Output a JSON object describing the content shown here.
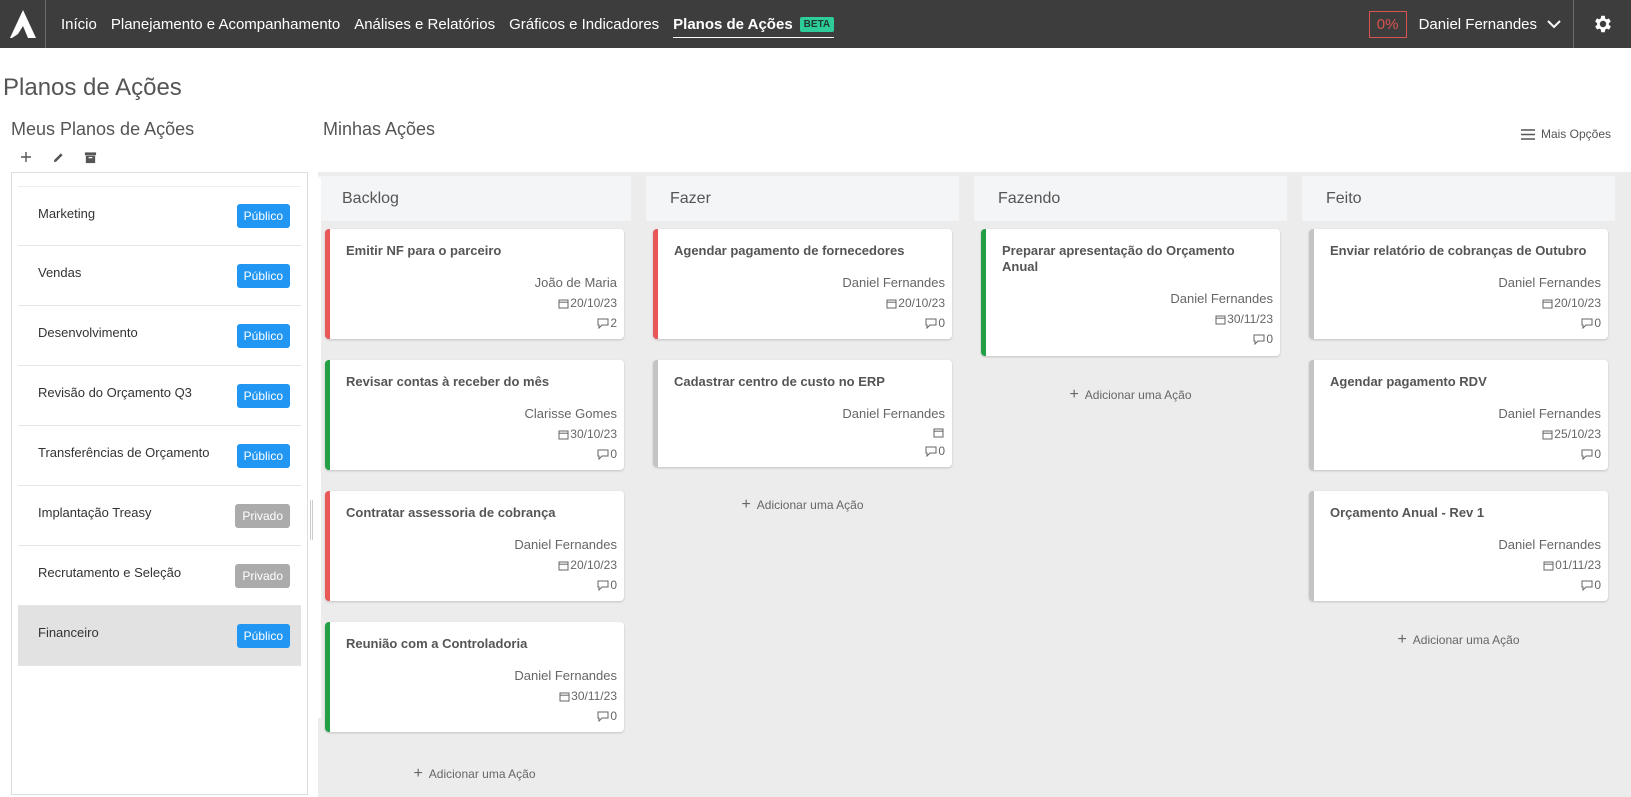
{
  "nav": {
    "items": [
      "Início",
      "Planejamento e Acompanhamento",
      "Análises e Relatórios",
      "Gráficos e Indicadores"
    ],
    "active": "Planos de Ações",
    "active_badge": "BETA"
  },
  "user": {
    "progress": "0%",
    "name": "Daniel Fernandes"
  },
  "page": {
    "title": "Planos de Ações"
  },
  "left": {
    "title": "Meus Planos de Ações",
    "plans": [
      {
        "name": "Marketing",
        "visibility": "Público"
      },
      {
        "name": "Vendas",
        "visibility": "Público"
      },
      {
        "name": "Desenvolvimento",
        "visibility": "Público"
      },
      {
        "name": "Revisão do Orçamento Q3",
        "visibility": "Público"
      },
      {
        "name": "Transferências de Orçamento",
        "visibility": "Público"
      },
      {
        "name": "Implantação Treasy",
        "visibility": "Privado"
      },
      {
        "name": "Recrutamento e Seleção",
        "visibility": "Privado"
      },
      {
        "name": "Financeiro",
        "visibility": "Público"
      }
    ]
  },
  "board": {
    "title": "Minhas Ações",
    "more_options": "Mais Opções",
    "add_action": "Adicionar uma Ação",
    "columns": [
      {
        "name": "Backlog",
        "cards": [
          {
            "title": "Emitir NF para o parceiro",
            "assignee": "João de Maria",
            "date": "20/10/23",
            "comments": "2"
          },
          {
            "title": "Revisar contas à receber do mês",
            "assignee": "Clarisse Gomes",
            "date": "30/10/23",
            "comments": "0"
          },
          {
            "title": "Contratar assessoria de cobrança",
            "assignee": "Daniel Fernandes",
            "date": "20/10/23",
            "comments": "0"
          },
          {
            "title": "Reunião com a Controladoria",
            "assignee": "Daniel Fernandes",
            "date": "30/11/23",
            "comments": "0"
          }
        ]
      },
      {
        "name": "Fazer",
        "cards": [
          {
            "title": "Agendar pagamento de fornecedores",
            "assignee": "Daniel Fernandes",
            "date": "20/10/23",
            "comments": "0"
          },
          {
            "title": "Cadastrar centro de custo no ERP",
            "assignee": "Daniel Fernandes",
            "date": "",
            "comments": "0"
          }
        ]
      },
      {
        "name": "Fazendo",
        "cards": [
          {
            "title": "Preparar apresentação do Orçamento Anual",
            "assignee": "Daniel Fernandes",
            "date": "30/11/23",
            "comments": "0"
          }
        ]
      },
      {
        "name": "Feito",
        "cards": [
          {
            "title": "Enviar relatório de cobranças de Outubro",
            "assignee": "Daniel Fernandes",
            "date": "20/10/23",
            "comments": "0"
          },
          {
            "title": "Agendar pagamento RDV",
            "assignee": "Daniel Fernandes",
            "date": "25/10/23",
            "comments": "0"
          },
          {
            "title": "Orçamento Anual - Rev 1",
            "assignee": "Daniel Fernandes",
            "date": "01/11/23",
            "comments": "0"
          }
        ]
      }
    ]
  },
  "colors": {
    "topbar": "#3d3d3d",
    "public": "#2196f3",
    "private": "#ababab",
    "red": "#ea5757",
    "green": "#23a047",
    "beta": "#2ecc9a"
  },
  "icons": [
    "treasy-logo-icon",
    "chevron-down-icon",
    "gear-icon",
    "plus-icon",
    "pencil-icon",
    "archive-icon",
    "menu-icon",
    "calendar-icon",
    "comment-icon"
  ]
}
